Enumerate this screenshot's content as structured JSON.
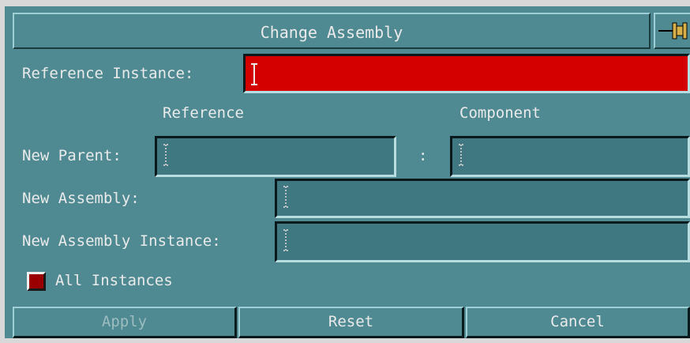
{
  "dialog": {
    "title": "Change Assembly",
    "reference_instance_label": "Reference Instance:",
    "reference_header": "Reference",
    "component_header": "Component",
    "new_parent_label": "New Parent:",
    "separator": ":",
    "new_assembly_label": "New Assembly:",
    "new_assembly_instance_label": "New Assembly Instance:",
    "all_instances_label": "All Instances",
    "fields": {
      "reference_instance": "",
      "new_parent_reference": "",
      "new_parent_component": "",
      "new_assembly": "",
      "new_assembly_instance": ""
    },
    "all_instances_checked": true
  },
  "buttons": {
    "apply": "Apply",
    "reset": "Reset",
    "cancel": "Cancel"
  },
  "colors": {
    "dialog_bg": "#4f8a92",
    "required_field": "#d40000",
    "checkbox_on": "#9a0000"
  },
  "icons": {
    "pin": "pushpin-icon",
    "text_cursor": "i-beam-icon"
  }
}
